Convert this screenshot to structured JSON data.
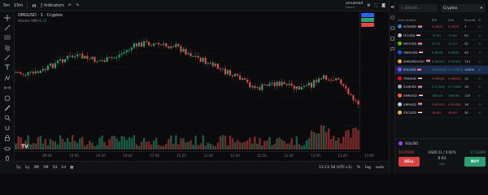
{
  "toolbar": {
    "timeframe": "5m",
    "interval": "15m",
    "indicators_label": "Indicators",
    "layout_name": "unnamed",
    "layout_status": "Saved"
  },
  "chart": {
    "symbol_line": "OMGUSD · 1 · Cryptos",
    "volume_label": "Volume",
    "volume_value": "SMA 9",
    "volume_value2": "13",
    "time_labels": [
      "09:40",
      "10:00",
      "10:20",
      "10:40",
      "11:00",
      "11:20",
      "11:40",
      "12:00",
      "12:20",
      "12:40",
      "13:00",
      "13:20",
      "11:00"
    ],
    "price_tags": [
      "",
      "",
      ""
    ],
    "tv_logo": "TV"
  },
  "bottombar": {
    "ranges": [
      "5y",
      "1y",
      "3M",
      "1M",
      "5d",
      "1d"
    ],
    "clock": "11:11:58 (UTC+1)",
    "options": [
      "%",
      "log",
      "auto"
    ]
  },
  "watchlist": {
    "search_placeholder": "Search...",
    "filter_value": "Cryptos",
    "columns": [
      "Instruments",
      "Bid",
      "Ask",
      "Spread",
      "D"
    ],
    "rows": [
      {
        "name": "XCNUSD",
        "bid": "0.1822",
        "ask": "0.1825",
        "spread": "3",
        "bid_class": "neg",
        "ask_class": "neg",
        "coin": "#3b7dd8"
      },
      {
        "name": "LTCUSD",
        "bid": "72.94",
        "ask": "71.80",
        "spread": "50",
        "bid_class": "pos",
        "ask_class": "pos",
        "coin": "#bfbfbf"
      },
      {
        "name": "NEOUSD",
        "bid": "11.21",
        "ask": "11.24",
        "spread": "30",
        "bid_class": "pos",
        "ask_class": "pos",
        "coin": "#58bf00"
      },
      {
        "name": "OMGUSD",
        "bid": "0.8558",
        "ask": "0.8562",
        "spread": "40",
        "bid_class": "pos",
        "ask_class": "pos",
        "coin": "#1a53f0"
      },
      {
        "name": "SHBUSD1000",
        "bid": "0.00923",
        "ask": "0.00924",
        "spread": "131",
        "bid_class": "pos",
        "ask_class": "pos",
        "coin": "#e5a93a"
      },
      {
        "name": "SOLUSD",
        "bid": "56.87250",
        "ask": "57.27000",
        "spread": "10000",
        "bid_class": "pos",
        "ask_class": "pos",
        "coin": "#9945ff"
      },
      {
        "name": "TRXUSD",
        "bid": "0.06540",
        "ask": "0.06550",
        "spread": "10",
        "bid_class": "neg",
        "ask_class": "neg",
        "coin": "#ef0027"
      },
      {
        "name": "XLMUSD",
        "bid": "0.11618",
        "ask": "0.11636",
        "spread": "18",
        "bid_class": "pos",
        "ask_class": "pos",
        "coin": "#aaaaaa"
      },
      {
        "name": "XMRUSD",
        "bid": "165.18",
        "ask": "166.38",
        "spread": "120",
        "bid_class": "pos",
        "ask_class": "pos",
        "coin": "#f26822"
      },
      {
        "name": "XRPUSD",
        "bid": "0.61412",
        "ask": "0.61428",
        "spread": "16",
        "bid_class": "neg",
        "ask_class": "neg",
        "coin": "#cccccc"
      },
      {
        "name": "ZECUSD",
        "bid": "28.60",
        "ask": "28.90",
        "spread": "30",
        "bid_class": "neg",
        "ask_class": "neg",
        "coin": "#ecb244"
      }
    ]
  },
  "trade": {
    "symbol": "SOLUSD",
    "bid": "56.87000",
    "spread_text": "USD0.11 / 0.02%",
    "ask": "57.21000",
    "sell_label": "SELL",
    "buy_label": "BUY",
    "lots_value": "0.01",
    "lots_unit": "lots"
  },
  "colors": {
    "up": "#2aa073",
    "down": "#e24b4b",
    "accent": "#2962ff"
  }
}
